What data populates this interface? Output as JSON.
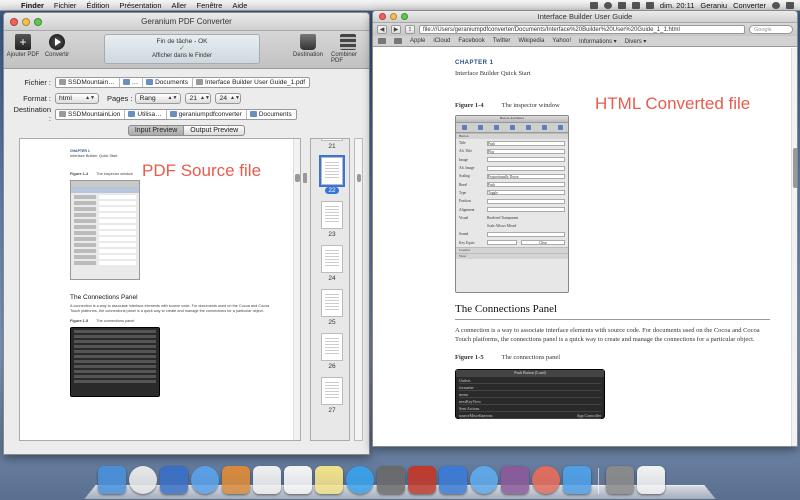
{
  "menubar": {
    "app": "Finder",
    "items": [
      "Fichier",
      "Édition",
      "Présentation",
      "Aller",
      "Fenêtre",
      "Aide"
    ],
    "clock": "dim. 20:11",
    "user": "Geraniu",
    "app_right": "Converter"
  },
  "converter": {
    "title": "Geranium PDF Converter",
    "toolbar": {
      "add": "Ajouter PDF",
      "convert": "Convertir",
      "destination": "Destination",
      "combine": "Combiner PDF"
    },
    "task": {
      "status": "Fin de tâche - OK",
      "check": "✓",
      "show": "Afficher dans le Finder"
    },
    "labels": {
      "file": "Fichier :",
      "format": "Format :",
      "pages": "Pages :",
      "destination": "Destination :"
    },
    "file_path": [
      "SSDMountain…",
      "…",
      "Documents",
      "Interface Builder User Guide_1.pdf"
    ],
    "format_value": "html",
    "pages_value": "Rang",
    "page_from": "21",
    "page_to": "24",
    "dest_path": [
      "SSDMountainLion",
      "Utilisa…",
      "geraniumpdfconverter",
      "Documents"
    ],
    "tabs": [
      "Input Preview",
      "Output Preview"
    ],
    "source_label": "PDF Source file",
    "source_doc": {
      "chapter": "CHAPTER 1",
      "section": "Interface Builder Quick Start",
      "fig1_num": "Figure 1-4",
      "fig1_title": "The inspector window",
      "heading": "The Connections Panel",
      "body": "A connection is a way to associate interface elements with source code. For documents used on the Cocoa and Cocoa Touch platforms, the connections panel is a quick way to create and manage the connections for a particular object.",
      "fig2_num": "Figure 1-5",
      "fig2_title": "The connections panel"
    },
    "thumbs": [
      {
        "label": "21",
        "selected": false
      },
      {
        "label": "22",
        "selected": true
      },
      {
        "label": "23",
        "selected": false
      },
      {
        "label": "24",
        "selected": false
      },
      {
        "label": "25",
        "selected": false
      },
      {
        "label": "26",
        "selected": false
      },
      {
        "label": "27",
        "selected": false
      }
    ]
  },
  "browser": {
    "title": "Interface Builder User Guide",
    "url": "file:///Users/geraniumpdfconverter/Documents/Interface%20Builder%20User%20Guide_1_1.html",
    "search_placeholder": "Google",
    "bookmarks": [
      "Apple",
      "iCloud",
      "Facebook",
      "Twitter",
      "Wikipedia",
      "Yahoo!",
      "Informations ▾",
      "Divers ▾"
    ],
    "output_label": "HTML Converted file",
    "doc": {
      "chapter": "CHAPTER 1",
      "section": "Interface Builder Quick Start",
      "fig1_num": "Figure 1-4",
      "fig1_title": "The inspector window",
      "heading": "The Connections Panel",
      "body": "A connection is a way to associate interface elements with source code. For documents used on the Cocoa and Cocoa Touch platforms, the connections panel is a quick way to create and manage the connections for a particular object.",
      "fig2_num": "Figure 1-5",
      "fig2_title": "The connections panel",
      "inspector_title": "Button Attributes",
      "inspector_section": "Button",
      "inspector_rows": [
        "Title",
        "Alt. Title",
        "Image",
        "Alt. Image",
        "Scaling",
        "Bezel",
        "Type",
        "Position",
        "Alignment",
        "Visual",
        "",
        "Sound",
        "Key Equiv."
      ],
      "inspector_values": [
        "Push",
        "Play",
        "",
        "",
        "Proportionally Down",
        "Push",
        "Toggle",
        "",
        "",
        "Bordered   Transparent",
        "Scale   Allows Mixed",
        "",
        "Clear"
      ],
      "inspector_foot1": "Control",
      "inspector_foot2": "View",
      "panel_title": "Push Button (Load)",
      "panel_rows": [
        "Outlets",
        "formatter",
        "menu",
        "nextKeyView",
        "Sent Actions",
        "sourceMiscellaneous"
      ],
      "panel_action": "App Controller"
    }
  },
  "dock": {
    "colors": [
      "#4a8fd8",
      "#e8e8e8",
      "#3a6fc4",
      "#5aa0e8",
      "#d98a3a",
      "#f0f0f0",
      "#f5f5f5",
      "#f3e28a",
      "#3aa0e8",
      "#6a6a6a",
      "#c0392b",
      "#3b7bd4",
      "#5fa8e8",
      "#8a5a9a",
      "#e46c5c",
      "#4f9fe6",
      "#8a8a8a",
      "#f2f2f2",
      "#7a7a7a"
    ]
  }
}
